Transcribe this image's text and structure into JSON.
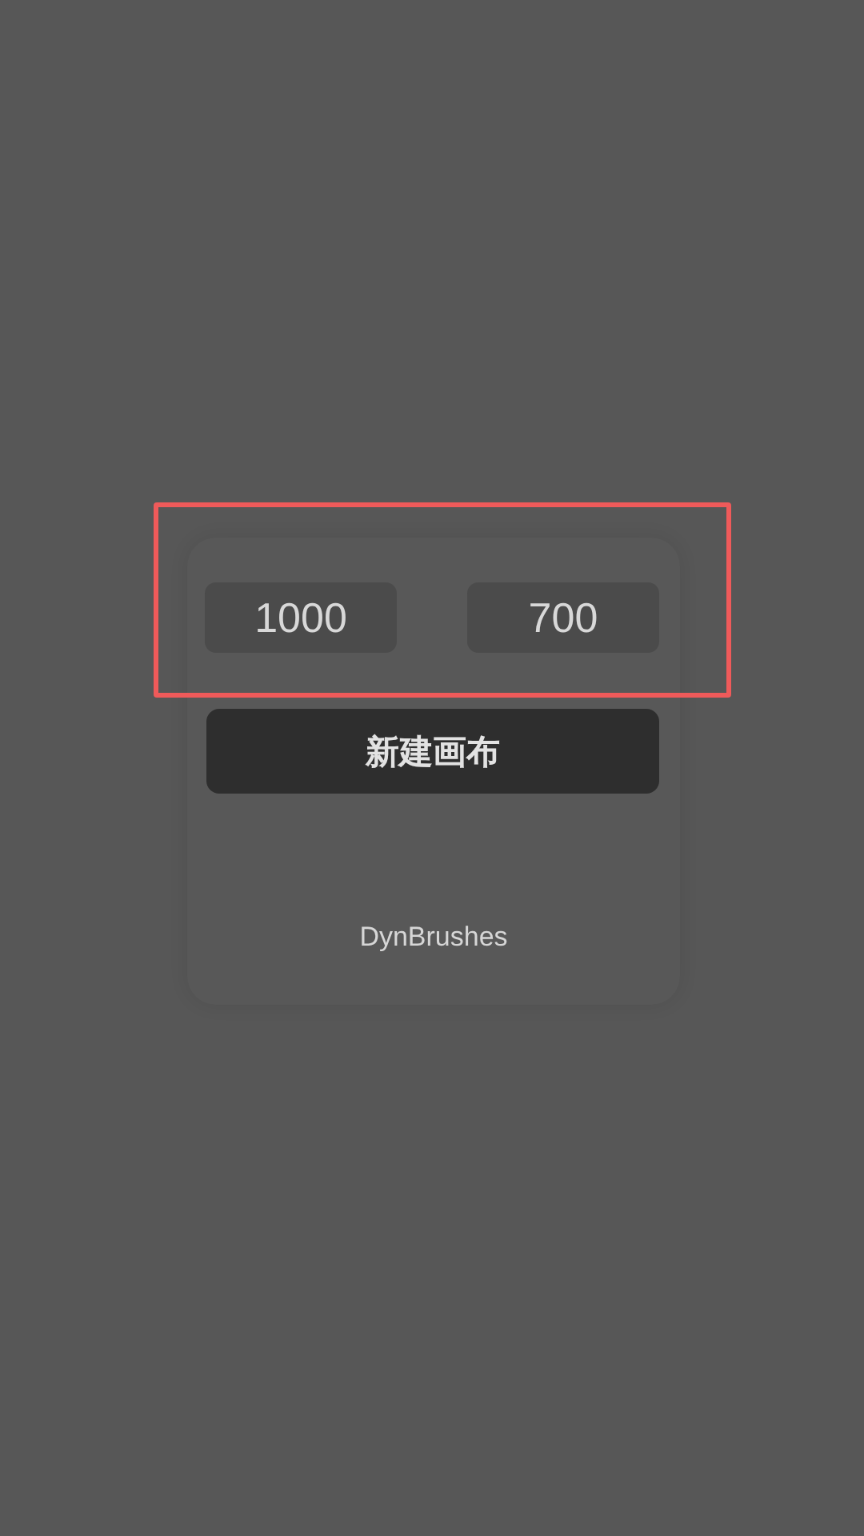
{
  "canvas_form": {
    "fields": [
      {
        "value": "1000"
      },
      {
        "value": "700"
      }
    ],
    "create_button": {
      "label": "新建画布"
    },
    "brand": "DynBrushes"
  },
  "highlight": {
    "shown": true
  }
}
